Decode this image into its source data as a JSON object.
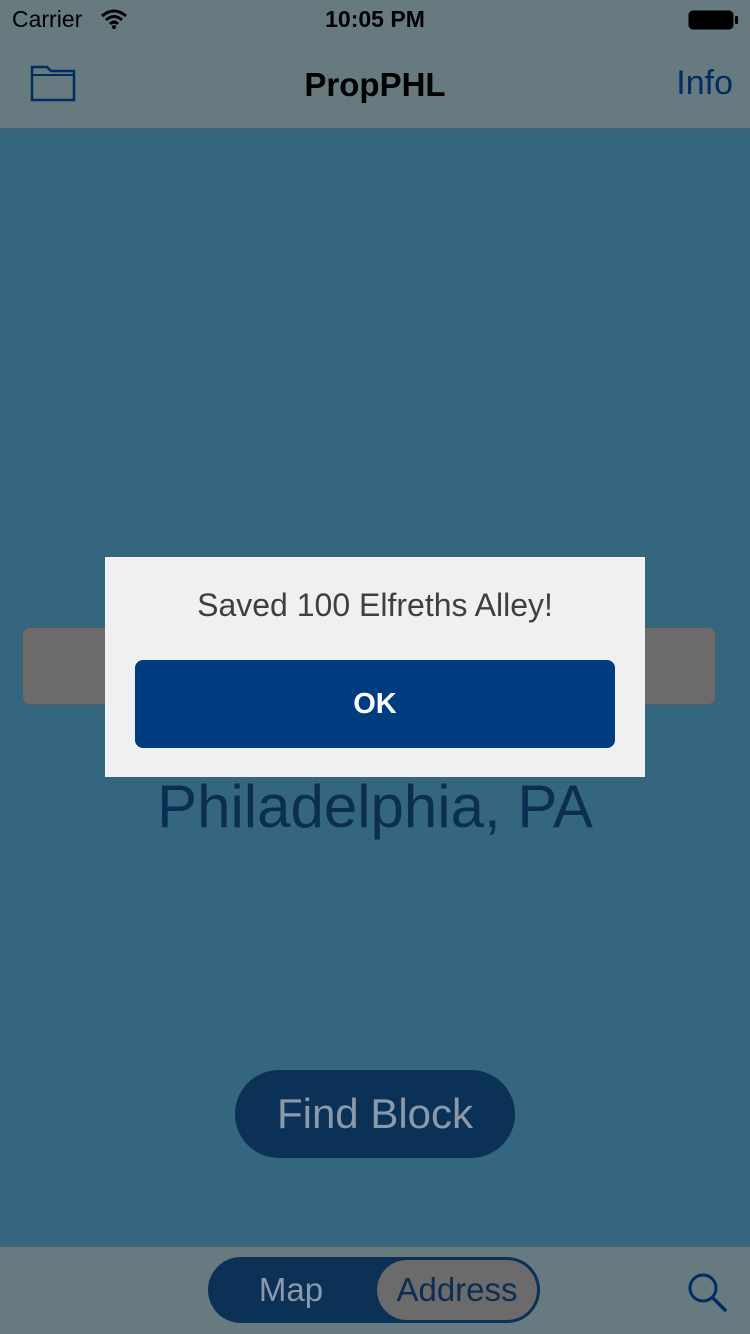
{
  "status_bar": {
    "carrier": "Carrier",
    "time": "10:05 PM",
    "wifi_icon": "wifi-icon",
    "battery_icon": "battery-icon"
  },
  "nav_bar": {
    "title": "PropPHL",
    "left_icon": "folder-icon",
    "right_button": "Info"
  },
  "main": {
    "address_input_value": "",
    "city_label": "Philadelphia, PA",
    "find_block_button": "Find Block"
  },
  "tab_bar": {
    "segments": [
      {
        "label": "Map",
        "selected": false
      },
      {
        "label": "Address",
        "selected": true
      }
    ],
    "search_icon": "search-icon"
  },
  "alert": {
    "message": "Saved 100 Elfreths Alley!",
    "ok_button": "OK"
  },
  "colors": {
    "background": "#34677f",
    "bars": "#667a80",
    "navy": "#0c3157",
    "alert_button": "#003c80",
    "alert_background": "#eff0f2"
  }
}
